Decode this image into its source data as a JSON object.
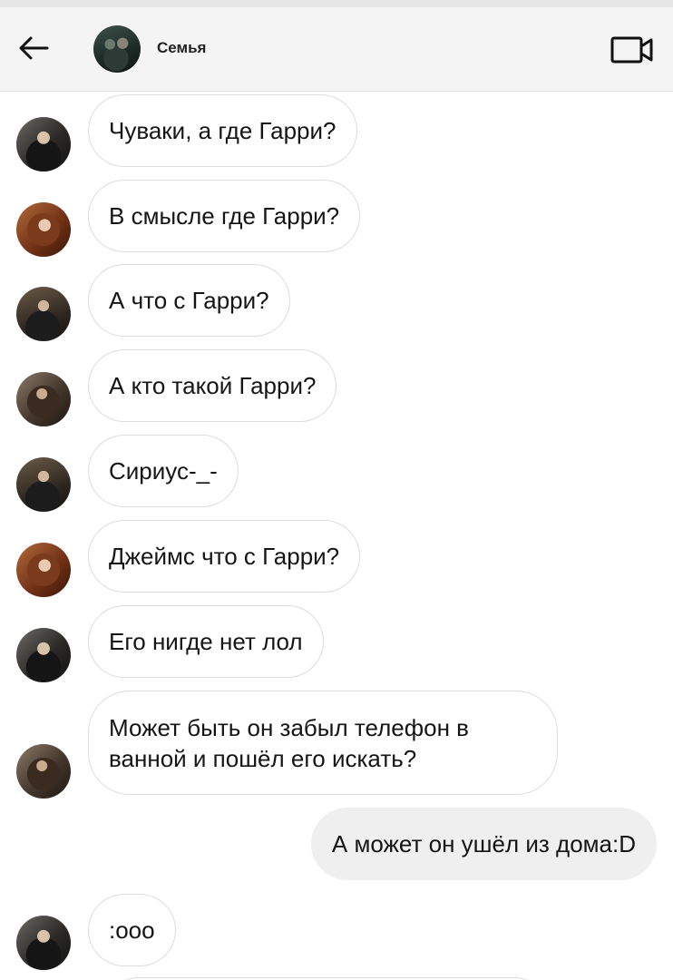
{
  "header": {
    "title": "Семья"
  },
  "messages": [
    {
      "avatar": "james",
      "text": "Чуваки, а где Гарри?"
    },
    {
      "avatar": "lily",
      "text": "В смысле где Гарри?"
    },
    {
      "avatar": "remus",
      "text": "А что с Гарри?"
    },
    {
      "avatar": "sirius",
      "text": "А кто такой Гарри?"
    },
    {
      "avatar": "remus",
      "text": "Сириус-_-"
    },
    {
      "avatar": "lily",
      "text": "Джеймс что с Гарри?"
    },
    {
      "avatar": "james",
      "text": "Его нигде нет лол"
    },
    {
      "avatar": "sirius",
      "text": "Может быть он забыл телефон в ванной и пошёл его искать?"
    },
    {
      "avatar": null,
      "text": "А может он ушёл из дома:D",
      "outgoing": true
    },
    {
      "avatar": "james",
      "text": ":ооо"
    }
  ],
  "icons": {
    "back": "arrow-left-icon",
    "video": "video-camera-icon"
  }
}
